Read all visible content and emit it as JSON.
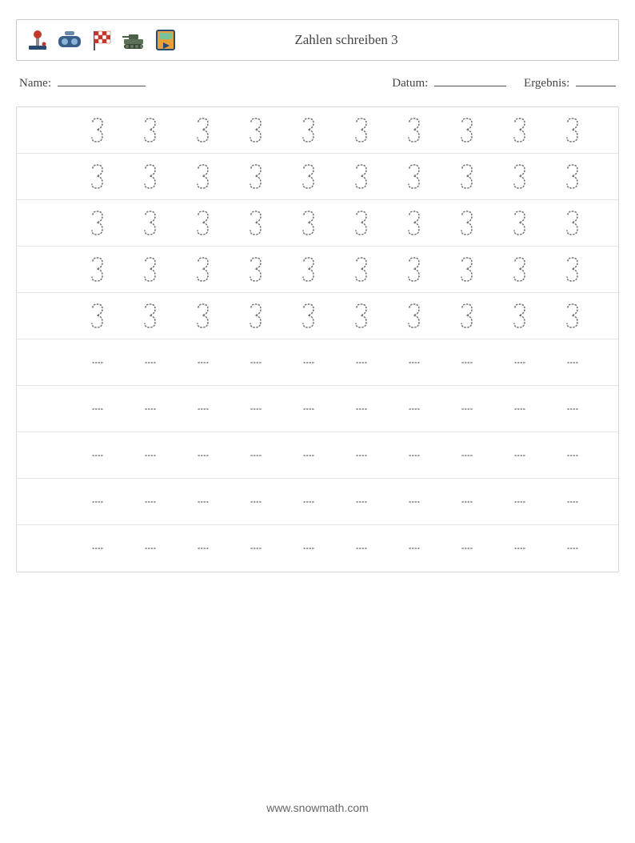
{
  "header": {
    "title": "Zahlen schreiben 3",
    "icons": [
      "joystick-icon",
      "vr-headset-icon",
      "checkered-flag-icon",
      "tank-icon",
      "play-screen-icon"
    ]
  },
  "meta": {
    "name_label": "Name:",
    "date_label": "Datum:",
    "result_label": "Ergebnis:"
  },
  "worksheet": {
    "digit": "3",
    "rows": [
      {
        "type": "digit",
        "count": 10
      },
      {
        "type": "digit",
        "count": 10
      },
      {
        "type": "digit",
        "count": 10
      },
      {
        "type": "digit",
        "count": 10
      },
      {
        "type": "digit",
        "count": 10
      },
      {
        "type": "dash",
        "count": 10
      },
      {
        "type": "dash",
        "count": 10
      },
      {
        "type": "dash",
        "count": 10
      },
      {
        "type": "dash",
        "count": 10
      },
      {
        "type": "dash",
        "count": 10
      }
    ]
  },
  "footer": {
    "url": "www.snowmath.com"
  }
}
